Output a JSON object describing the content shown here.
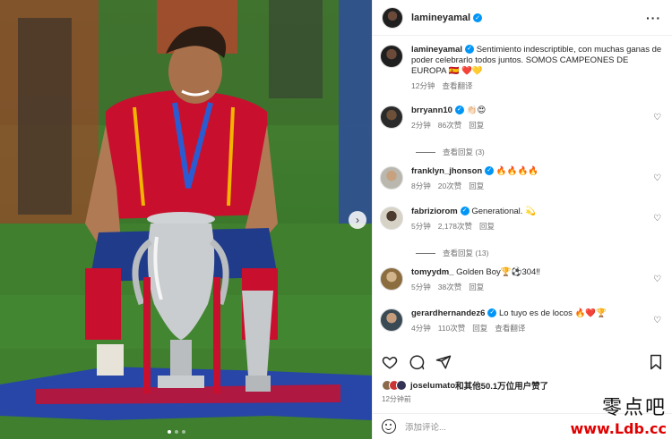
{
  "post_author": {
    "username": "lamineyamal",
    "more_label": "···"
  },
  "caption": {
    "username": "lamineyamal",
    "text": "Sentimiento indescriptible, con muchas ganas de poder celebrarlo todos juntos. SOMOS CAMPEONES DE EUROPA 🇪🇸 ❤️💛",
    "time": "12分钟",
    "translate_label": "查看翻译"
  },
  "comments": [
    {
      "username": "brryann10",
      "text": "👏🏻😍",
      "time": "2分钟",
      "likes": "86次赞",
      "reply_label": "回复",
      "view_replies": "查看回复 (3)"
    },
    {
      "username": "franklyn_jhonson",
      "text": "🔥🔥🔥🔥",
      "time": "8分钟",
      "likes": "20次赞",
      "reply_label": "回复",
      "view_replies": ""
    },
    {
      "username": "fabriziorom",
      "text": "Generational. 💫",
      "time": "5分钟",
      "likes": "2,178次赞",
      "reply_label": "回复",
      "view_replies": "查看回复 (13)"
    },
    {
      "username": "tomyydm_",
      "text": "Golden Boy🏆⚽304‼",
      "time": "5分钟",
      "likes": "38次赞",
      "reply_label": "回复",
      "view_replies": ""
    },
    {
      "username": "gerardhernandez6",
      "text": "Lo tuyo es de locos 🔥❤️🏆",
      "time": "4分钟",
      "likes": "110次赞",
      "reply_label": "回复",
      "view_replies": "",
      "translate_label": "查看翻译"
    }
  ],
  "likes": {
    "bold_user": "joselumato",
    "text": "和其他50.1万位用户赞了"
  },
  "posted_time": "12分钟前",
  "add_comment_placeholder": "添加评论...",
  "watermark": {
    "cn": "零点吧",
    "url": "www.Ldb.cc"
  },
  "icons": {
    "like": "heart-icon",
    "comment": "comment-icon",
    "share": "share-icon",
    "save": "bookmark-icon",
    "emoji": "emoji-icon",
    "verified": "verified-badge-icon"
  },
  "colors": {
    "verified": "#0095f6",
    "watermark_url": "#e00000",
    "spain_red": "#c8102e"
  }
}
